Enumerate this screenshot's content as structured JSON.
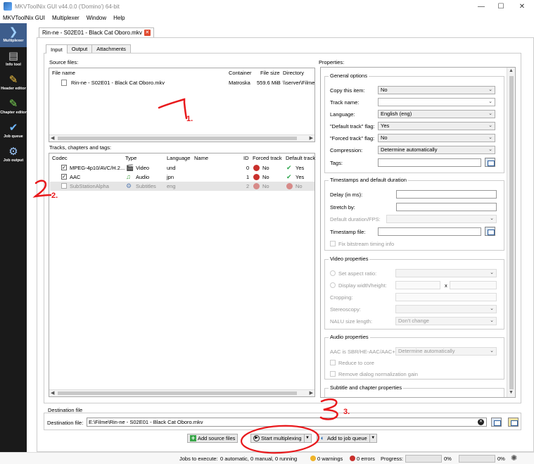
{
  "window": {
    "title": "MKVToolNix GUI v44.0.0 ('Domino') 64-bit",
    "min": "—",
    "max": "☐",
    "close": "✕"
  },
  "menu": [
    "MKVToolNix GUI",
    "Multiplexer",
    "Window",
    "Help"
  ],
  "sidebar": [
    {
      "label": "Multiplexer",
      "icon": "multiplexer-icon",
      "glyph": "❯"
    },
    {
      "label": "Info tool",
      "icon": "info-tool-icon",
      "glyph": "▤"
    },
    {
      "label": "Header editor",
      "icon": "header-editor-icon",
      "glyph": "✎"
    },
    {
      "label": "Chapter editor",
      "icon": "chapter-editor-icon",
      "glyph": "✎"
    },
    {
      "label": "Job queue",
      "icon": "job-queue-icon",
      "glyph": "✔"
    },
    {
      "label": "Job output",
      "icon": "job-output-icon",
      "glyph": "⚙"
    }
  ],
  "doc_tab": {
    "label": "Rin-ne - S02E01 - Black Cat Oboro.mkv",
    "close": "✕"
  },
  "inner_tabs": [
    "Input",
    "Output",
    "Attachments"
  ],
  "source_files": {
    "label": "Source files:",
    "headers": [
      "File name",
      "Container",
      "File size",
      "Directory"
    ],
    "rows": [
      {
        "name": "Rin-ne - S02E01 - Black Cat Oboro.mkv",
        "container": "Matroska",
        "size": "559.6 MiB",
        "dir": "\\\\server\\Filme"
      }
    ]
  },
  "tracks": {
    "label": "Tracks, chapters and tags:",
    "headers": [
      "Codec",
      "Type",
      "Language",
      "Name",
      "ID",
      "Forced track",
      "Default track"
    ],
    "rows": [
      {
        "checked": true,
        "codec": "MPEG-4p10/AVC/H.2...",
        "type": "Video",
        "lang": "und",
        "id": "0",
        "forced": "No",
        "default": "Yes",
        "dim": false
      },
      {
        "checked": true,
        "codec": "AAC",
        "type": "Audio",
        "lang": "jpn",
        "id": "1",
        "forced": "No",
        "default": "Yes",
        "dim": false
      },
      {
        "checked": false,
        "codec": "SubStationAlpha",
        "type": "Subtitles",
        "lang": "eng",
        "id": "2",
        "forced": "No",
        "default": "No",
        "dim": true
      }
    ]
  },
  "properties": {
    "label": "Properties:",
    "general": {
      "title": "General options",
      "copy_item": {
        "label": "Copy this item:",
        "value": "No"
      },
      "track_name": {
        "label": "Track name:",
        "value": ""
      },
      "language": {
        "label": "Language:",
        "value": "English (eng)"
      },
      "default_flag": {
        "label": "\"Default track\" flag:",
        "value": "Yes"
      },
      "forced_flag": {
        "label": "\"Forced track\" flag:",
        "value": "No"
      },
      "compression": {
        "label": "Compression:",
        "value": "Determine automatically"
      },
      "tags": {
        "label": "Tags:"
      }
    },
    "timestamps": {
      "title": "Timestamps and default duration",
      "delay": "Delay (in ms):",
      "stretch": "Stretch by:",
      "duration": "Default duration/FPS:",
      "timestamp_file": "Timestamp file:",
      "fix_bitstream": "Fix bitstream timing info"
    },
    "video": {
      "title": "Video properties",
      "aspect": "Set aspect ratio:",
      "display": "Display width/height:",
      "x": "x",
      "cropping": "Cropping:",
      "stereoscopy": "Stereoscopy:",
      "nalu": "NALU size length:",
      "nalu_value": "Don't change"
    },
    "audio": {
      "title": "Audio properties",
      "sbr": "AAC is SBR/HE-AAC/AAC+:",
      "sbr_value": "Determine automatically",
      "reduce": "Reduce to core",
      "remove_dialog": "Remove dialog normalization gain"
    },
    "subtitle": {
      "title": "Subtitle and chapter properties"
    }
  },
  "destination": {
    "frame_label": "Destination file",
    "label": "Destination file:",
    "value": "E:\\Filme\\Rin-ne - S02E01 - Black Cat Oboro.mkv"
  },
  "buttons": {
    "add_source": "Add source files",
    "start": "Start multiplexing",
    "add_queue": "Add to job queue"
  },
  "status": {
    "jobs": "Jobs to execute:",
    "jobs_value": "0 automatic, 0 manual, 0 running",
    "warnings": "0 warnings",
    "errors": "0 errors",
    "progress": "Progress:",
    "progress_1": "0%",
    "progress_2": "0%"
  },
  "annotations": [
    "1.",
    "2.",
    "3."
  ],
  "colors": {
    "sidebar": "#1a1a1a",
    "sidebar_active": "#3d5d8c",
    "annotation": "#e8191c"
  }
}
